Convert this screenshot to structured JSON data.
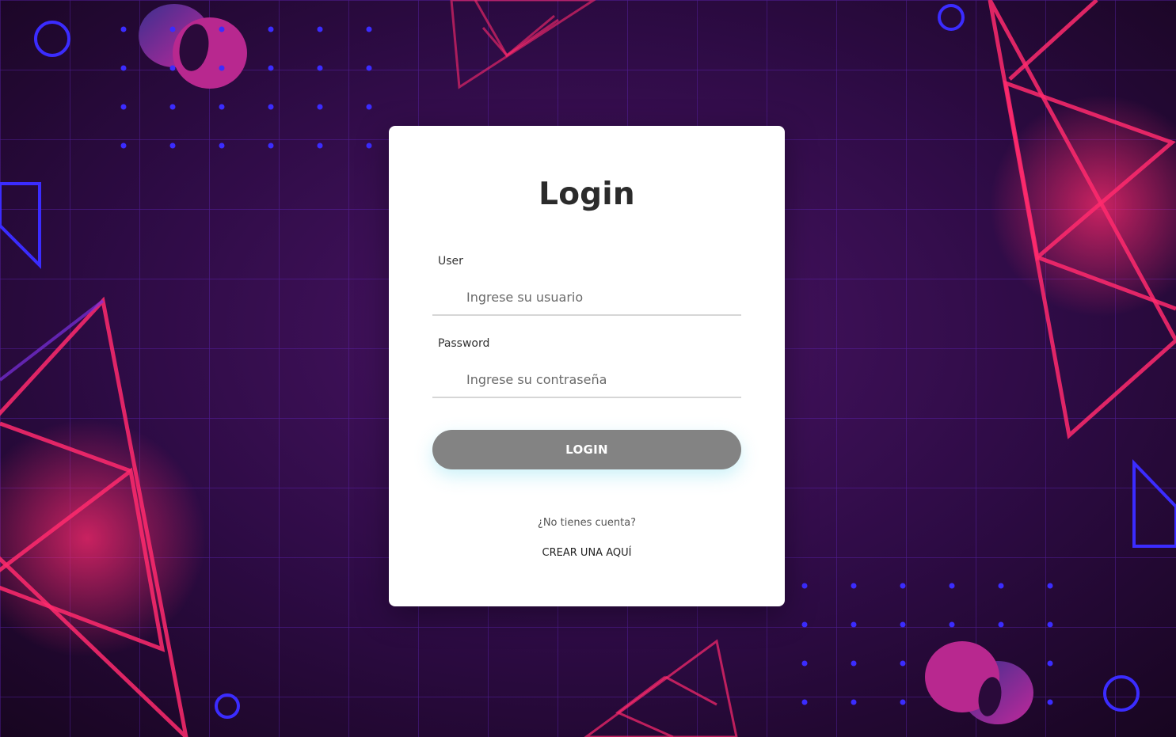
{
  "login": {
    "title": "Login",
    "user_label": "User",
    "user_placeholder": "Ingrese su usuario",
    "password_label": "Password",
    "password_placeholder": "Ingrese su contraseña",
    "submit_label": "LOGIN",
    "no_account_text": "¿No tienes cuenta?",
    "create_link_text": "CREAR UNA AQUÍ"
  },
  "theme": {
    "background_base": "#2a0a3a",
    "grid_color": "#5a1fb0",
    "triangle_pink": "#ff2d7a",
    "accent_blue": "#3b2cff",
    "button_gray": "#838383",
    "card_bg": "#ffffff"
  }
}
